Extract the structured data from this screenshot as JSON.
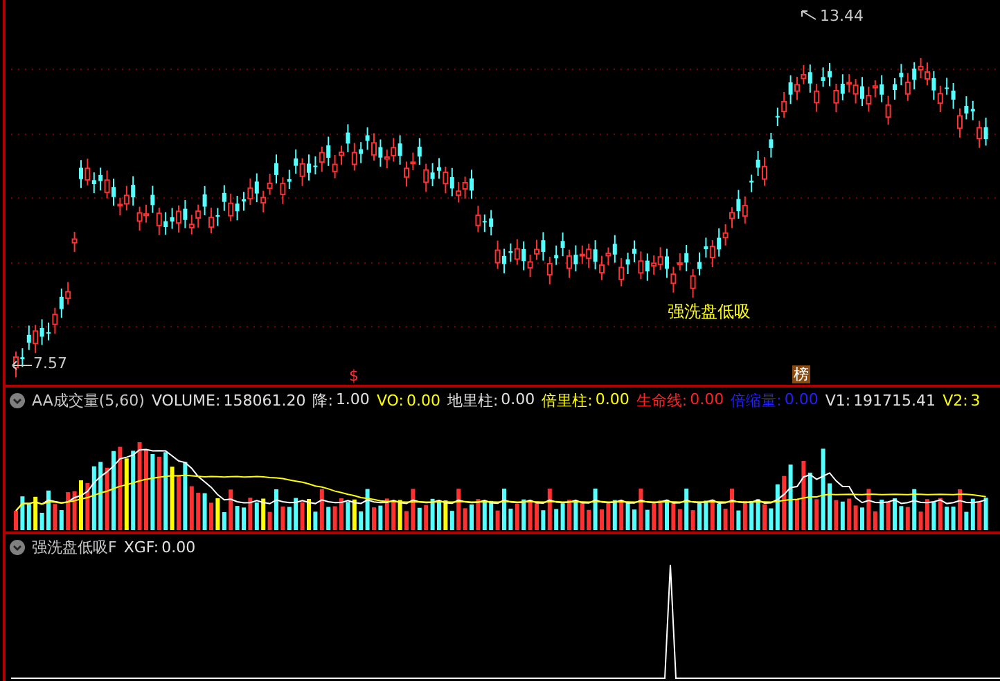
{
  "main_chart": {
    "high_label": "13.44",
    "low_label": "7.57",
    "signal_label": "强洗盘低吸",
    "markers": [
      {
        "kind": "dollar",
        "text": "$"
      },
      {
        "kind": "badge",
        "text": "榜"
      }
    ]
  },
  "volume_panel": {
    "title": "AA成交量(5,60)",
    "legend": [
      {
        "label": "VOLUME:",
        "value": "158061.20",
        "color": "#e0e0e0"
      },
      {
        "label": "降:",
        "value": "1.00",
        "color": "#e0e0e0"
      },
      {
        "label": "VO:",
        "value": "0.00",
        "color": "#ffff00"
      },
      {
        "label": "地里柱:",
        "value": "0.00",
        "color": "#e0e0e0"
      },
      {
        "label": "倍里柱:",
        "value": "0.00",
        "color": "#ffff00"
      },
      {
        "label": "生命线:",
        "value": "0.00",
        "color": "#ff2020"
      },
      {
        "label": "倍缩量:",
        "value": "0.00",
        "color": "#2020ff"
      },
      {
        "label": "V1:",
        "value": "191715.41",
        "color": "#e0e0e0"
      },
      {
        "label": "V2:",
        "value": "3",
        "color": "#ffff00"
      }
    ]
  },
  "indicator_panel": {
    "title": "强洗盘低吸F",
    "legend": [
      {
        "label": "XGF:",
        "value": "0.00",
        "color": "#e0e0e0"
      }
    ]
  }
}
